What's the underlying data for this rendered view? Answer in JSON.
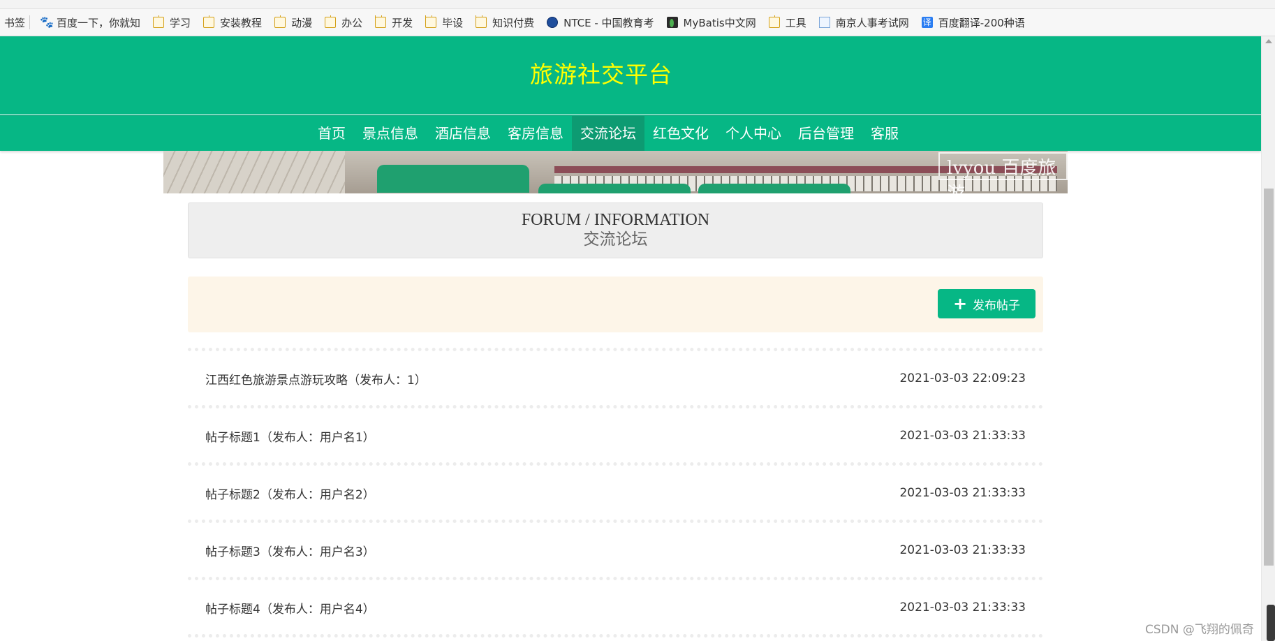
{
  "bookmarks": {
    "label": "书签",
    "items": [
      {
        "label": "百度一下，你就知",
        "icon": "baidu-paw-icon"
      },
      {
        "label": "学习",
        "icon": "folder-icon"
      },
      {
        "label": "安装教程",
        "icon": "folder-icon"
      },
      {
        "label": "动漫",
        "icon": "folder-icon"
      },
      {
        "label": "办公",
        "icon": "folder-icon"
      },
      {
        "label": "开发",
        "icon": "folder-icon"
      },
      {
        "label": "毕设",
        "icon": "folder-icon"
      },
      {
        "label": "知识付费",
        "icon": "folder-icon"
      },
      {
        "label": "NTCE - 中国教育考",
        "icon": "globe-icon"
      },
      {
        "label": "MyBatis中文网",
        "icon": "leaf-icon"
      },
      {
        "label": "工具",
        "icon": "folder-icon"
      },
      {
        "label": "南京人事考试网",
        "icon": "doc-icon"
      },
      {
        "label": "百度翻译-200种语",
        "icon": "translate-icon"
      }
    ]
  },
  "header": {
    "site_title": "旅游社交平台"
  },
  "nav": {
    "items": [
      {
        "label": "首页",
        "active": false
      },
      {
        "label": "景点信息",
        "active": false
      },
      {
        "label": "酒店信息",
        "active": false
      },
      {
        "label": "客房信息",
        "active": false
      },
      {
        "label": "交流论坛",
        "active": true
      },
      {
        "label": "红色文化",
        "active": false
      },
      {
        "label": "个人中心",
        "active": false
      },
      {
        "label": "后台管理",
        "active": false
      },
      {
        "label": "客服",
        "active": false
      }
    ]
  },
  "banner": {
    "watermark": "lvyou 百度旅游"
  },
  "section": {
    "title_en": "FORUM / INFORMATION",
    "title_cn": "交流论坛"
  },
  "actions": {
    "post_label": "发布帖子"
  },
  "posts": [
    {
      "title": "江西红色旅游景点游玩攻略（发布人：1）",
      "time": "2021-03-03 22:09:23"
    },
    {
      "title": "帖子标题1（发布人：用户名1）",
      "time": "2021-03-03 21:33:33"
    },
    {
      "title": "帖子标题2（发布人：用户名2）",
      "time": "2021-03-03 21:33:33"
    },
    {
      "title": "帖子标题3（发布人：用户名3）",
      "time": "2021-03-03 21:33:33"
    },
    {
      "title": "帖子标题4（发布人：用户名4）",
      "time": "2021-03-03 21:33:33"
    }
  ],
  "watermark": "CSDN @飞翔的佩奇",
  "colors": {
    "primary": "#06b785",
    "nav_active": "#0d9b72",
    "title_yellow": "#ffff00",
    "action_bar_bg": "#fdf5e8"
  }
}
